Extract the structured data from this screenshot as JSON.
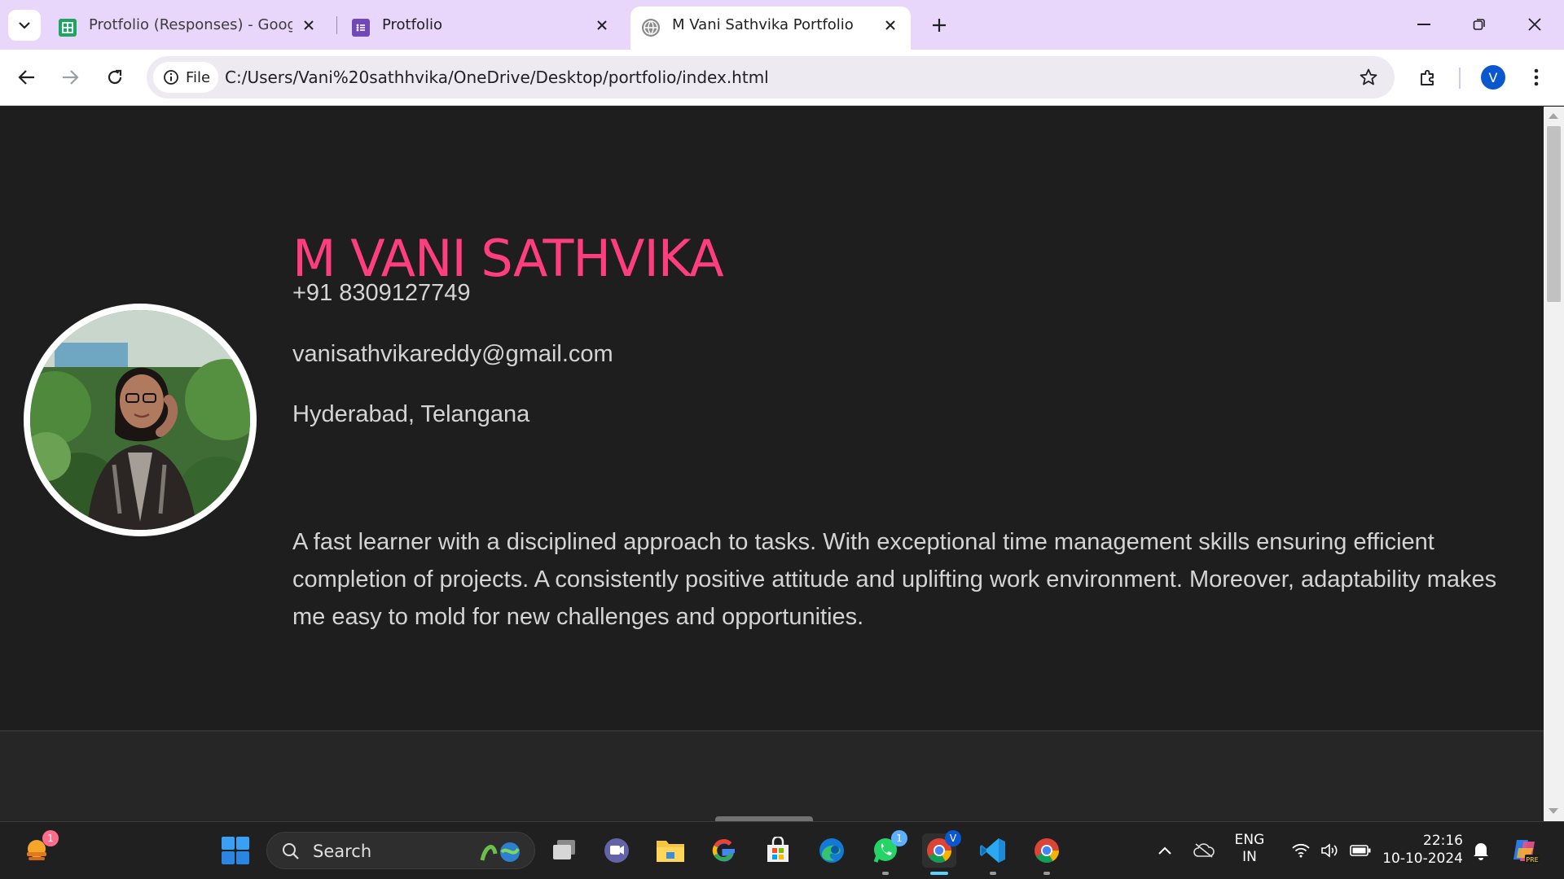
{
  "browser": {
    "tabs": [
      {
        "title": "Protfolio (Responses) - Google F",
        "favicon": "google-sheets-icon",
        "active": false
      },
      {
        "title": "Protfolio",
        "favicon": "google-forms-icon",
        "active": false
      },
      {
        "title": "M Vani Sathvika Portfolio",
        "favicon": "globe-icon",
        "active": true
      }
    ],
    "address": {
      "chip_label": "File",
      "url": "C:/Users/Vani%20sathhvika/OneDrive/Desktop/portfolio/index.html"
    },
    "profile_initial": "V",
    "colors": {
      "tabstrip": "#e9d6fb",
      "omnibox": "#eeeaf2",
      "profile": "#0b57d0"
    }
  },
  "page": {
    "name": "M VANI SATHVIKA",
    "phone": "+91 8309127749",
    "email": "vanisathvikareddy@gmail.com",
    "location": "Hyderabad, Telangana",
    "bio": "A fast learner with a disciplined approach to tasks. With exceptional time management skills ensuring efficient completion of projects. A consistently positive attitude and uplifting work environment. Moreover, adaptability makes me easy to mold for new challenges and opportunities.",
    "colors": {
      "background": "#1e1e1e",
      "accent": "#ff3d7f",
      "text": "#d4d4d4"
    },
    "scroll_fraction": 0.0
  },
  "taskbar": {
    "search_label": "Search",
    "widgets_badge": "1",
    "whatsapp_badge": "1",
    "chrome_profile_badge": "V",
    "language": {
      "line1": "ENG",
      "line2": "IN"
    },
    "clock": {
      "time": "22:16",
      "date": "10-10-2024"
    },
    "apps": [
      "start-icon",
      "task-view-icon",
      "teams-chat-icon",
      "file-explorer-icon",
      "google-icon",
      "microsoft-store-icon",
      "edge-icon",
      "whatsapp-icon",
      "chrome-icon",
      "vscode-icon",
      "chrome-icon"
    ]
  }
}
